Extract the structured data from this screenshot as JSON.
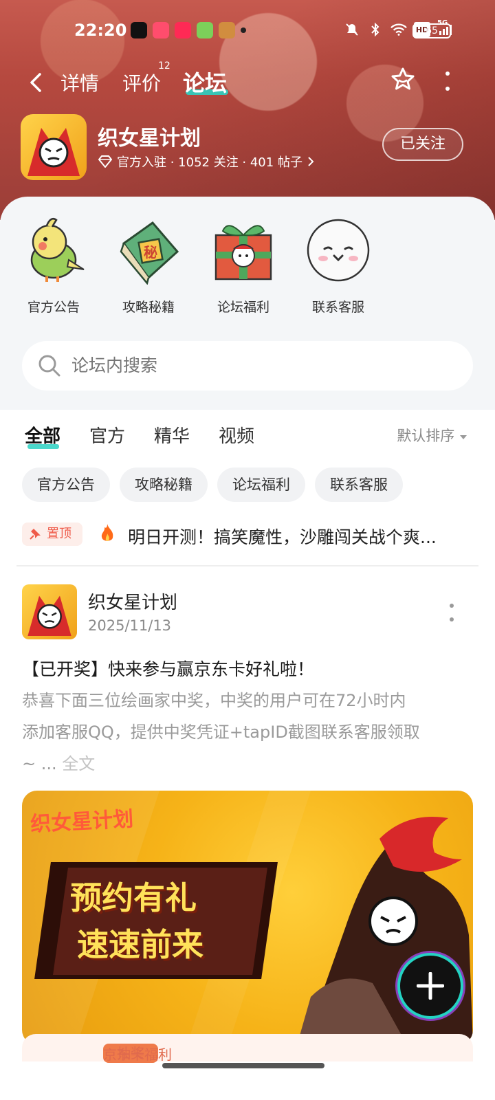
{
  "status_bar": {
    "time": "22:20",
    "network": "HD",
    "cellular": "5G",
    "battery": "65"
  },
  "nav": {
    "tabs": [
      {
        "label": "详情"
      },
      {
        "label": "评价",
        "badge": "12"
      },
      {
        "label": "论坛",
        "active": true
      }
    ]
  },
  "game": {
    "name": "织女星计划",
    "meta": "官方入驻 · 1052 关注 · 401 帖子",
    "follow_label": "已关注"
  },
  "shortcuts": [
    {
      "label": "官方公告",
      "icon": "parrot-icon"
    },
    {
      "label": "攻略秘籍",
      "icon": "secret-book-icon"
    },
    {
      "label": "论坛福利",
      "icon": "gift-box-icon"
    },
    {
      "label": "联系客服",
      "icon": "service-face-icon"
    }
  ],
  "search": {
    "placeholder": "论坛内搜索"
  },
  "tabs": [
    {
      "label": "全部",
      "active": true
    },
    {
      "label": "官方"
    },
    {
      "label": "精华"
    },
    {
      "label": "视频"
    }
  ],
  "sort_label": "默认排序",
  "chips": [
    "官方公告",
    "攻略秘籍",
    "论坛福利",
    "联系客服"
  ],
  "pinned": {
    "badge": "置顶",
    "title": "明日开测！搞笑魔性，沙雕闯关战个爽..."
  },
  "post": {
    "author": "织女星计划",
    "date": "2025/11/13",
    "title": "【已开奖】快来参与赢京东卡好礼啦！",
    "body_line1": "恭喜下面三位绘画家中奖，中奖的用户可在72小时内",
    "body_line2": "添加客服QQ，提供中奖凭证+tapID截图联系客服领取",
    "body_line3_prefix": "~ ... ",
    "more_label": "全文",
    "banner": {
      "logo": "织女星计划",
      "line1": "预约有礼",
      "line2": "速速前来"
    }
  },
  "next_card": {
    "badge": "抽奖",
    "title": "京东卡福利"
  },
  "colors": {
    "accent": "#2bd1c2",
    "pin_red": "#ef5b4a",
    "hero": "#b6493f"
  }
}
